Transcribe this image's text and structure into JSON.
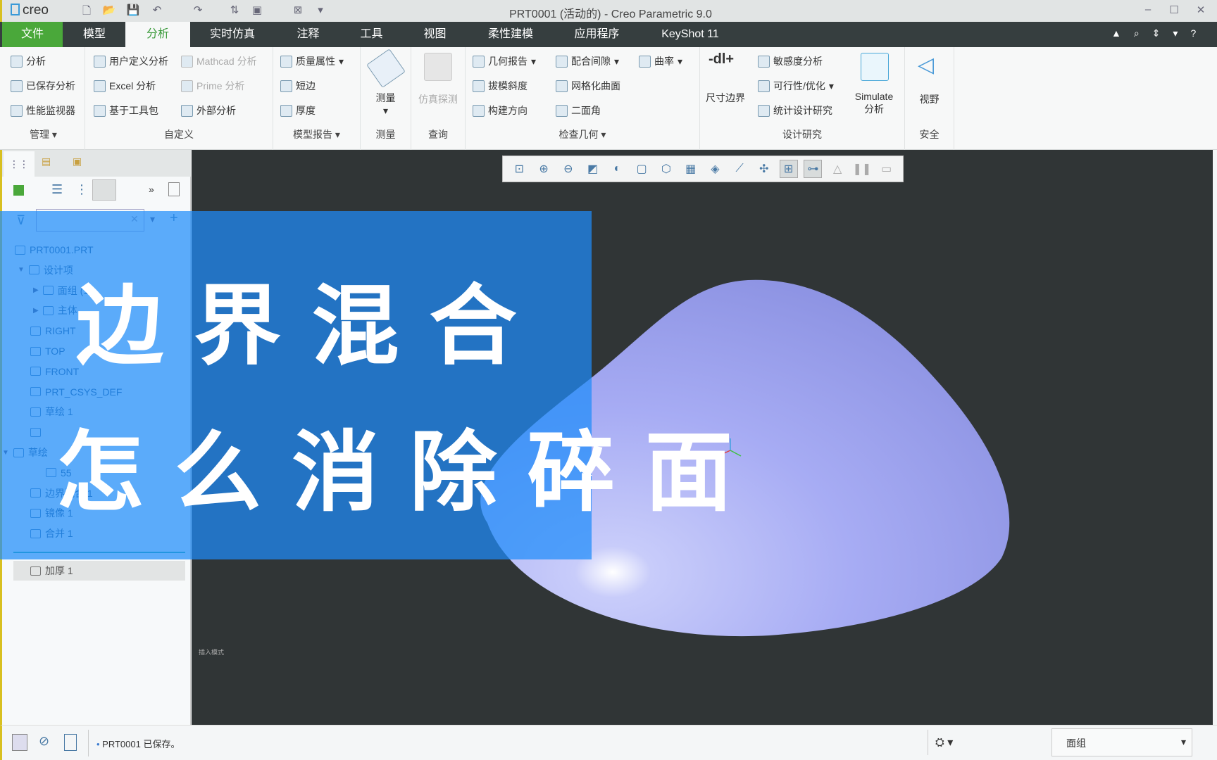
{
  "window": {
    "logo": "creo",
    "title": "PRT0001 (活动的) - Creo Parametric 9.0",
    "controls": [
      "minimize",
      "maximize",
      "close"
    ]
  },
  "tabs": [
    {
      "label": "文件"
    },
    {
      "label": "模型"
    },
    {
      "label": "分析",
      "active": true
    },
    {
      "label": "实时仿真"
    },
    {
      "label": "注释"
    },
    {
      "label": "工具"
    },
    {
      "label": "视图"
    },
    {
      "label": "柔性建模"
    },
    {
      "label": "应用程序"
    },
    {
      "label": "KeyShot 11"
    }
  ],
  "ribbon": {
    "manage": {
      "label": "管理",
      "items": [
        "分析",
        "已保存分析",
        "性能监视器"
      ]
    },
    "custom": {
      "label": "自定义",
      "items": [
        "用户定义分析",
        "Excel 分析",
        "基于工具包",
        "Mathcad 分析",
        "Prime 分析",
        "外部分析"
      ]
    },
    "model_report": {
      "label": "模型报告",
      "items": [
        "质量属性",
        "短边",
        "厚度"
      ]
    },
    "measure": {
      "label": "测量",
      "button": "测量"
    },
    "query": {
      "label": "查询",
      "button": "仿真探测"
    },
    "inspect": {
      "label": "检查几何",
      "items": [
        "几何报告",
        "拔模斜度",
        "构建方向",
        "配合间隙",
        "网格化曲面",
        "二面角",
        "曲率"
      ]
    },
    "design_study": {
      "label": "设计研究",
      "items": [
        "尺寸边界",
        "敏感度分析",
        "可行性/优化",
        "统计设计研究",
        "Simulate",
        "分析"
      ]
    },
    "safety": {
      "label": "安全",
      "button": "视野"
    }
  },
  "tree": {
    "items": [
      "PRT0001.PRT",
      "设计项",
      "面组 (1)",
      "主体",
      "RIGHT",
      "TOP",
      "FRONT",
      "PRT_CSYS_DEF",
      "草绘 1",
      "",
      "草绘",
      "55",
      "边界混合 1",
      "镜像 1",
      "合并 1"
    ],
    "insert_item": "加厚 1"
  },
  "viewport": {
    "hint": "插入模式",
    "model_color": "#a3a8f3",
    "background": "#303536"
  },
  "overlay": {
    "line1": "边 界 混 合",
    "line2": "怎 么 消 除 碎 面",
    "color": "#1e8cfa"
  },
  "status": {
    "message": "PRT0001 已保存。",
    "filter": "面组"
  }
}
